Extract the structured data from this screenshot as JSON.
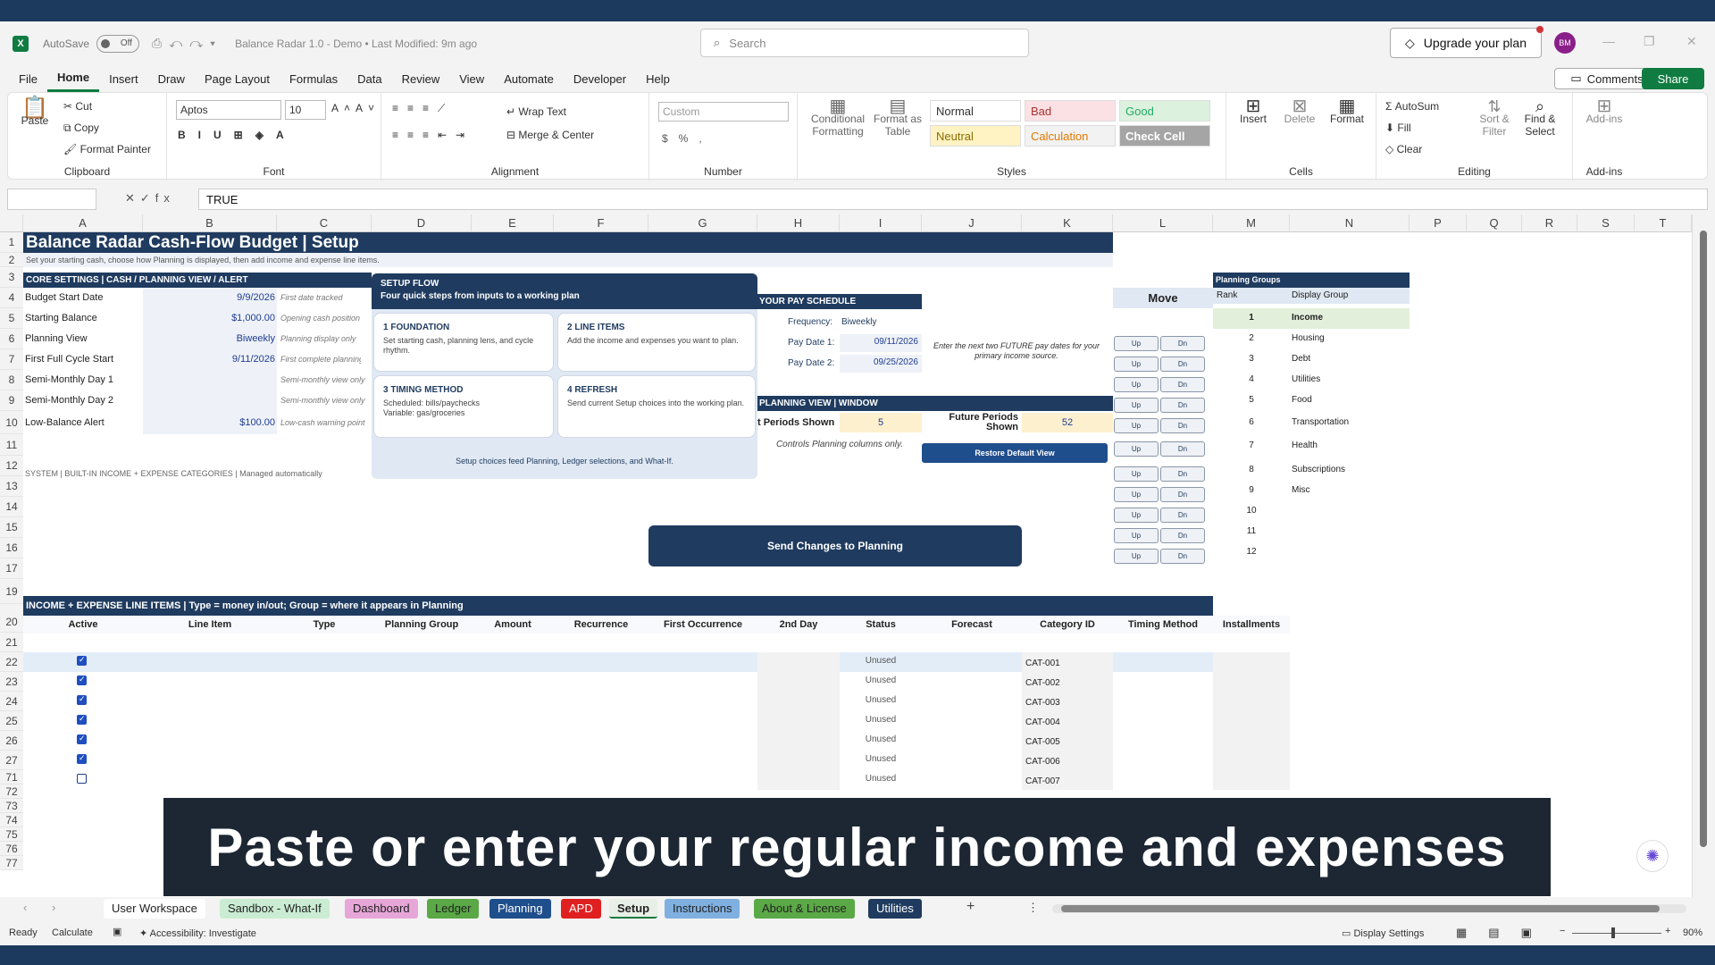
{
  "title_bar": {
    "app_logo": "X",
    "autosave_label": "AutoSave",
    "autosave_state": "Off",
    "doc_title": "Balance Radar 1.0 - Demo  •  Last Modified: 9m ago",
    "search_placeholder": "Search",
    "upgrade_label": "Upgrade your plan",
    "avatar_initials": "BM"
  },
  "menu": [
    "File",
    "Home",
    "Insert",
    "Draw",
    "Page Layout",
    "Formulas",
    "Data",
    "Review",
    "View",
    "Automate",
    "Developer",
    "Help"
  ],
  "menu_active": "Home",
  "comments_label": "Comments",
  "share_label": "Share",
  "ribbon": {
    "clipboard": {
      "paste": "Paste",
      "cut": "Cut",
      "copy": "Copy",
      "format_painter": "Format Painter",
      "label": "Clipboard"
    },
    "font": {
      "name": "Aptos",
      "size": "10",
      "label": "Font"
    },
    "alignment": {
      "wrap": "Wrap Text",
      "merge": "Merge & Center",
      "label": "Alignment"
    },
    "number": {
      "format": "Custom",
      "label": "Number"
    },
    "styles": {
      "conditional": "Conditional Formatting",
      "format_table": "Format as Table",
      "normal": "Normal",
      "bad": "Bad",
      "good": "Good",
      "neutral": "Neutral",
      "calculation": "Calculation",
      "check_cell": "Check Cell",
      "label": "Styles"
    },
    "cells": {
      "insert": "Insert",
      "delete": "Delete",
      "format": "Format",
      "label": "Cells"
    },
    "editing": {
      "autosum": "AutoSum",
      "fill": "Fill",
      "clear": "Clear",
      "sort": "Sort & Filter",
      "find": "Find & Select",
      "label": "Editing"
    },
    "addins": {
      "addins": "Add-ins",
      "label": "Add-ins"
    }
  },
  "formula_bar": {
    "value": "TRUE"
  },
  "columns": [
    "A",
    "B",
    "C",
    "D",
    "E",
    "F",
    "G",
    "H",
    "I",
    "J",
    "K",
    "L",
    "M",
    "N",
    "P",
    "Q",
    "R",
    "S",
    "T"
  ],
  "rows": [
    "1",
    "2",
    "3",
    "4",
    "5",
    "6",
    "7",
    "8",
    "9",
    "10",
    "11",
    "12",
    "13",
    "14",
    "15",
    "16",
    "17",
    "19",
    "20",
    "21",
    "22",
    "23",
    "24",
    "25",
    "26",
    "27",
    "71",
    "72",
    "73",
    "74",
    "75",
    "76",
    "77"
  ],
  "sheet": {
    "title": "Balance Radar Cash-Flow Budget | Setup",
    "subtitle": "Set your starting cash, choose how Planning is displayed, then add income and expense line items.",
    "core_header": "CORE SETTINGS | CASH / PLANNING VIEW / ALERT",
    "core_rows": [
      {
        "label": "Budget Start Date",
        "value": "9/9/2026",
        "hint": "First date tracked"
      },
      {
        "label": "Starting Balance",
        "value": "$1,000.00",
        "hint": "Opening cash position"
      },
      {
        "label": "Planning View",
        "value": "Biweekly",
        "hint": "Planning display only"
      },
      {
        "label": "First Full Cycle Start",
        "value": "9/11/2026",
        "hint": "First complete planning cycle"
      },
      {
        "label": "Semi-Monthly Day 1",
        "value": "",
        "hint": "Semi-monthly view only"
      },
      {
        "label": "Semi-Monthly Day 2",
        "value": "",
        "hint": "Semi-monthly view only"
      },
      {
        "label": "Low-Balance Alert",
        "value": "$100.00",
        "hint": "Low-cash warning point"
      }
    ],
    "system_line": "SYSTEM | BUILT-IN INCOME + EXPENSE CATEGORIES |  Managed automatically",
    "setup_flow": {
      "title": "SETUP FLOW",
      "subtitle": "Four quick steps from inputs to a working plan",
      "steps": [
        {
          "title": "1  FOUNDATION",
          "desc": "Set starting cash, planning lens, and cycle rhythm."
        },
        {
          "title": "2  LINE ITEMS",
          "desc": "Add the income and expenses you want to plan."
        },
        {
          "title": "3  TIMING METHOD",
          "desc": "Scheduled: bills/paychecks Variable: gas/groceries"
        },
        {
          "title": "4  REFRESH",
          "desc": "Send current Setup choices into the working plan."
        }
      ],
      "footer": "Setup choices feed Planning, Ledger selections, and What-If."
    },
    "pay_schedule": {
      "header": "YOUR PAY SCHEDULE",
      "freq_label": "Frequency:",
      "freq_value": "Biweekly",
      "date1_label": "Pay Date 1:",
      "date1_value": "09/11/2026",
      "date2_label": "Pay Date 2:",
      "date2_value": "09/25/2026",
      "note": "Enter the next two FUTURE pay dates for your primary income source."
    },
    "planning_window": {
      "header": "PLANNING VIEW | WINDOW",
      "past_label": "t Periods Shown",
      "past_value": "5",
      "future_label": "Future Periods Shown",
      "future_value": "52",
      "note": "Controls Planning columns only.",
      "restore_button": "Restore Default View"
    },
    "send_button": "Send Changes to Planning",
    "move_header": "Move",
    "move_up": "Up",
    "move_dn": "Dn",
    "groups": {
      "header": "Planning Groups",
      "rank_label": "Rank",
      "display_label": "Display Group",
      "items": [
        {
          "rank": "1",
          "name": "Income"
        },
        {
          "rank": "2",
          "name": "Housing"
        },
        {
          "rank": "3",
          "name": "Debt"
        },
        {
          "rank": "4",
          "name": "Utilities"
        },
        {
          "rank": "5",
          "name": "Food"
        },
        {
          "rank": "6",
          "name": "Transportation"
        },
        {
          "rank": "7",
          "name": "Health"
        },
        {
          "rank": "8",
          "name": "Subscriptions"
        },
        {
          "rank": "9",
          "name": "Misc"
        },
        {
          "rank": "10",
          "name": ""
        },
        {
          "rank": "11",
          "name": ""
        },
        {
          "rank": "12",
          "name": ""
        }
      ]
    },
    "line_items_header": "INCOME + EXPENSE LINE ITEMS  |  Type = money in/out; Group = where it appears in Planning",
    "table_columns": [
      "Active",
      "Line Item",
      "Type",
      "Planning Group",
      "Amount",
      "Recurrence",
      "First Occurrence",
      "2nd Day",
      "Status",
      "Forecast",
      "Category ID",
      "Timing Method",
      "Installments"
    ],
    "table_rows": [
      {
        "active": true,
        "status": "Unused",
        "cat": "CAT-001"
      },
      {
        "active": true,
        "status": "Unused",
        "cat": "CAT-002"
      },
      {
        "active": true,
        "status": "Unused",
        "cat": "CAT-003"
      },
      {
        "active": true,
        "status": "Unused",
        "cat": "CAT-004"
      },
      {
        "active": true,
        "status": "Unused",
        "cat": "CAT-005"
      },
      {
        "active": true,
        "status": "Unused",
        "cat": "CAT-006"
      },
      {
        "active": false,
        "status": "Unused",
        "cat": "CAT-007"
      }
    ]
  },
  "caption": "Paste or enter your regular income and expenses",
  "sheet_tabs": [
    {
      "name": "User Workspace",
      "color": "#ffffff"
    },
    {
      "name": "Sandbox - What-If",
      "color": "#c9ecd2"
    },
    {
      "name": "Dashboard",
      "color": "#e7a6d8"
    },
    {
      "name": "Ledger",
      "color": "#5aa846"
    },
    {
      "name": "Planning",
      "color": "#1f4e8c"
    },
    {
      "name": "APD",
      "color": "#e02020"
    },
    {
      "name": "Setup",
      "color": "#e8efe6"
    },
    {
      "name": "Instructions",
      "color": "#7fb0e0"
    },
    {
      "name": "About & License",
      "color": "#5aa846"
    },
    {
      "name": "Utilities",
      "color": "#1f3b5f"
    }
  ],
  "active_tab": "Setup",
  "status": {
    "ready": "Ready",
    "calculate": "Calculate",
    "accessibility": "Accessibility: Investigate",
    "display_settings": "Display Settings",
    "zoom": "90%"
  }
}
